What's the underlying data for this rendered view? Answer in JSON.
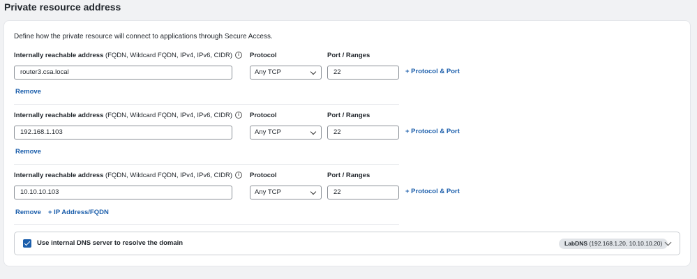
{
  "section": {
    "title": "Private resource address"
  },
  "intro_text": "Define how the private resource will connect to applications through Secure Access.",
  "labels": {
    "address_bold": "Internally reachable address",
    "address_hint": " (FQDN, Wildcard FQDN, IPv4, IPv6, CIDR)",
    "protocol": "Protocol",
    "port": "Port / Ranges"
  },
  "rows": [
    {
      "address": "router3.csa.local",
      "protocol": "Any TCP",
      "port": "22",
      "add_protocol_port": "+ Protocol & Port",
      "remove": "Remove"
    },
    {
      "address": "192.168.1.103",
      "protocol": "Any TCP",
      "port": "22",
      "add_protocol_port": "+ Protocol & Port",
      "remove": "Remove"
    },
    {
      "address": "10.10.10.103",
      "protocol": "Any TCP",
      "port": "22",
      "add_protocol_port": "+ Protocol & Port",
      "remove": "Remove"
    }
  ],
  "add_ip_fqdn": "+ IP Address/FQDN",
  "dns": {
    "checkbox_checked": true,
    "label": "Use internal DNS server to resolve the domain",
    "badge_name": "LabDNS",
    "badge_detail": " (192.168.1.20, 10.10.10.20)"
  },
  "colors": {
    "accent": "#1b5eab",
    "background": "#f1f2f4",
    "card": "#ffffff"
  },
  "icons": {
    "info": "info-circle-icon",
    "dropdown": "chevron-down-icon",
    "check": "checkmark-icon"
  }
}
